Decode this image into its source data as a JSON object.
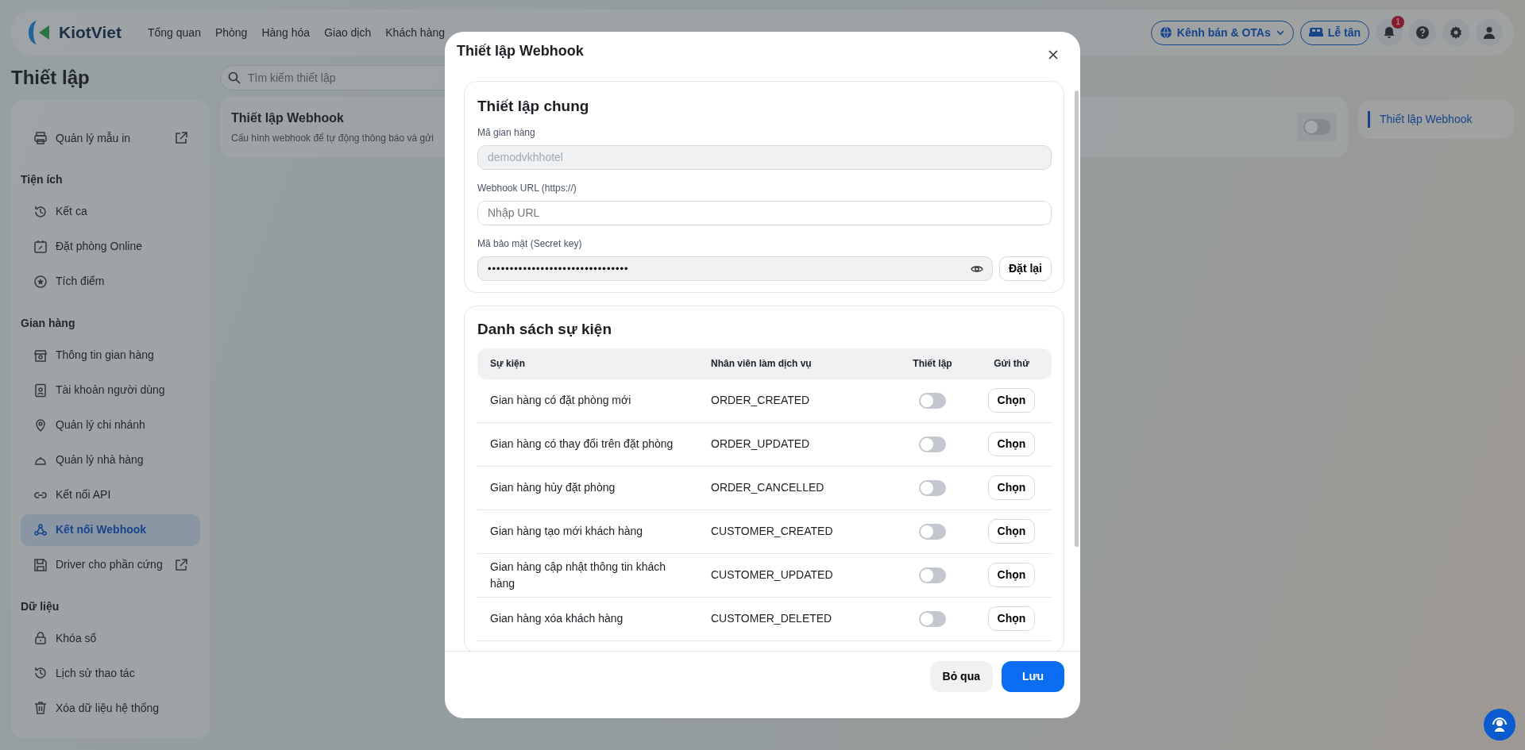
{
  "header": {
    "logo_text": "KiotViet",
    "nav": [
      "Tổng quan",
      "Phòng",
      "Hàng hóa",
      "Giao dịch",
      "Khách hàng"
    ],
    "channel_button": "Kênh bán & OTAs",
    "reception_button": "Lễ tân",
    "notification_count": "1"
  },
  "page_title": "Thiết lập",
  "search": {
    "placeholder": "Tìm kiếm thiết lập"
  },
  "sidebar": {
    "top_items": [
      {
        "label": "Quản lý mẫu in",
        "external": true,
        "selected": false
      }
    ],
    "sections": [
      {
        "heading": "Tiện ích",
        "items": [
          {
            "label": "Kết ca",
            "external": false,
            "selected": false
          },
          {
            "label": "Đặt phòng Online",
            "external": false,
            "selected": false
          },
          {
            "label": "Tích điểm",
            "external": false,
            "selected": false
          }
        ]
      },
      {
        "heading": "Gian hàng",
        "items": [
          {
            "label": "Thông tin gian hàng",
            "external": false,
            "selected": false
          },
          {
            "label": "Tài khoản người dùng",
            "external": false,
            "selected": false
          },
          {
            "label": "Quản lý chi nhánh",
            "external": false,
            "selected": false
          },
          {
            "label": "Quản lý nhà hàng",
            "external": false,
            "selected": false
          },
          {
            "label": "Kết nối API",
            "external": false,
            "selected": false
          },
          {
            "label": "Kết nối Webhook",
            "external": false,
            "selected": true
          },
          {
            "label": "Driver cho phần cứng",
            "external": true,
            "selected": false
          }
        ]
      },
      {
        "heading": "Dữ liệu",
        "items": [
          {
            "label": "Khóa sổ",
            "external": false,
            "selected": false
          },
          {
            "label": "Lịch sử thao tác",
            "external": false,
            "selected": false
          },
          {
            "label": "Xóa dữ liệu hệ thống",
            "external": false,
            "selected": false
          }
        ]
      }
    ]
  },
  "setting_card": {
    "title": "Thiết lập Webhook",
    "description": "Cấu hình webhook để tự động thông báo và gửi",
    "on": false
  },
  "toc": [
    {
      "label": "Thiết lập Webhook",
      "selected": true
    }
  ],
  "modal": {
    "title": "Thiết lập Webhook",
    "general": {
      "title": "Thiết lập chung",
      "store_code": {
        "label": "Mã gian hàng",
        "value": "demodvkhhotel",
        "disabled": true
      },
      "url": {
        "label": "Webhook URL (https://)",
        "placeholder": "Nhập URL"
      },
      "secret": {
        "label": "Mã bảo mật (Secret key)",
        "value": "••••••••••••••••••••••••••••••••",
        "button": "Đặt lại"
      }
    },
    "events": {
      "title": "Danh sách sự kiện",
      "columns": [
        "Sự kiện",
        "Nhân viên làm dịch vụ",
        "Thiết lập",
        "Gửi thử"
      ],
      "rows": [
        {
          "event": "Gian hàng có đặt phòng mới",
          "code": "ORDER_CREATED",
          "on": false,
          "button": "Chọn"
        },
        {
          "event": "Gian hàng có thay đổi trên đặt phòng",
          "code": "ORDER_UPDATED",
          "on": false,
          "button": "Chọn"
        },
        {
          "event": "Gian hàng hủy đặt phòng",
          "code": "ORDER_CANCELLED",
          "on": false,
          "button": "Chọn"
        },
        {
          "event": "Gian hàng tạo mới khách hàng",
          "code": "CUSTOMER_CREATED",
          "on": false,
          "button": "Chọn"
        },
        {
          "event": "Gian hàng cập nhật thông tin khách hàng",
          "code": "CUSTOMER_UPDATED",
          "on": false,
          "button": "Chọn"
        },
        {
          "event": "Gian hàng xóa khách hàng",
          "code": "CUSTOMER_DELETED",
          "on": false,
          "button": "Chọn"
        }
      ]
    },
    "cancel_button": "Bỏ qua",
    "save_button": "Lưu"
  }
}
